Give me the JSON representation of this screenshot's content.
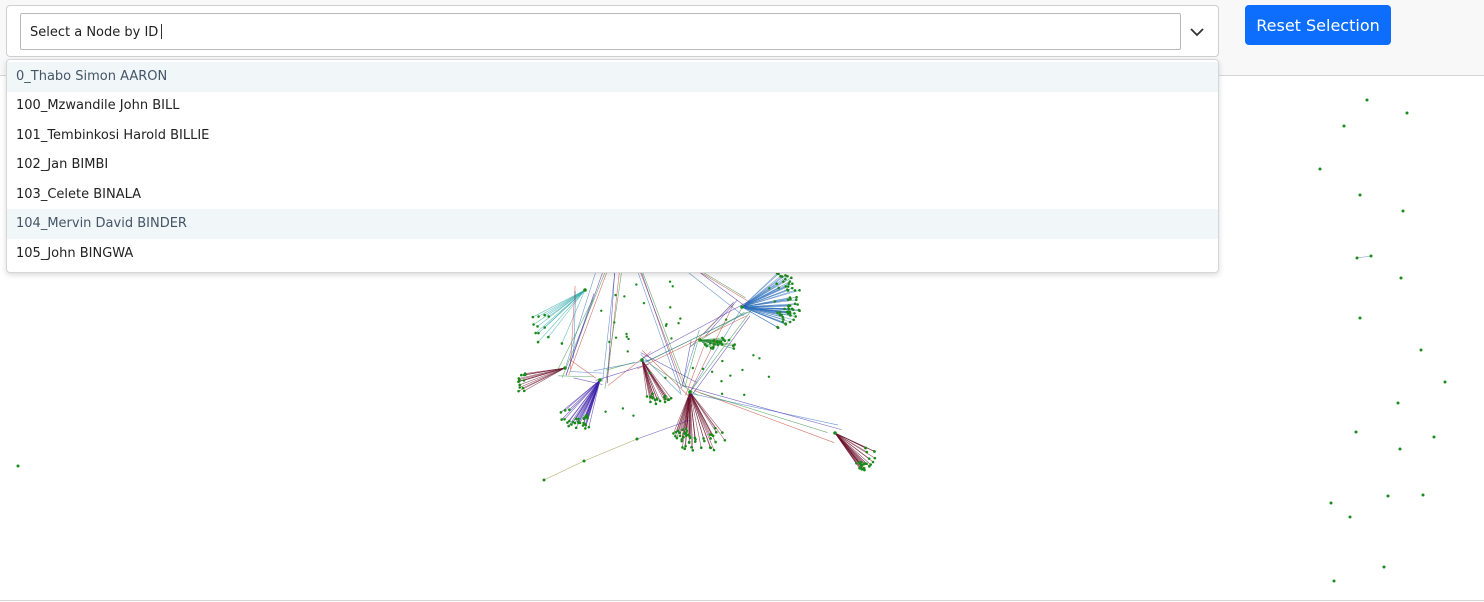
{
  "toolbar": {
    "select_placeholder": "Select a Node by ID",
    "reset_label": "Reset Selection",
    "chevron_icon": "chevron-down-icon"
  },
  "dropdown": {
    "options": [
      {
        "label": "0_Thabo Simon AARON",
        "highlighted": true
      },
      {
        "label": "100_Mzwandile John BILL",
        "highlighted": false
      },
      {
        "label": "101_Tembinkosi Harold BILLIE",
        "highlighted": false
      },
      {
        "label": "102_Jan BIMBI",
        "highlighted": false
      },
      {
        "label": "103_Celete BINALA",
        "highlighted": false
      },
      {
        "label": "104_Mervin David BINDER",
        "highlighted": true
      },
      {
        "label": "105_John BINGWA",
        "highlighted": false
      }
    ]
  },
  "graph": {
    "node_color": "#1a8a1a",
    "edge_colors": [
      "#c0392b",
      "#2e6fba",
      "#3b1fa8",
      "#2c8a3a",
      "#6b0f2a",
      "#2aa6a6",
      "#8a8a2a"
    ],
    "button_color": "#0d6efd"
  }
}
